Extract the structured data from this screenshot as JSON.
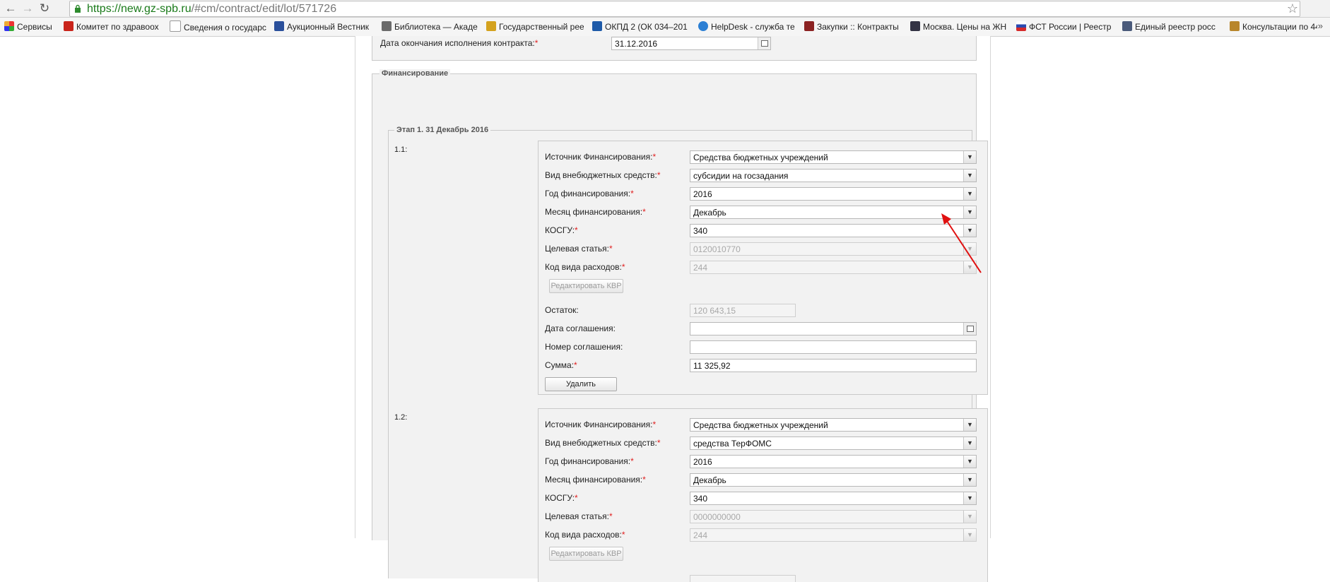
{
  "browser": {
    "url_host": "https://new.gz-spb.ru",
    "url_path": "/#cm/contract/edit/lot/571726",
    "bookmarks": [
      "Сервисы",
      "Комитет по здравоох",
      "Сведения о государс",
      "Аукционный Вестник",
      "Библиотека — Акаде",
      "Государственный рее",
      "ОКПД 2 (ОК 034–201",
      "HelpDesk - служба те",
      "Закупки :: Контракты",
      "Москва. Цены на ЖН",
      "ФСТ России | Реестр",
      "Единый реестр росс",
      "Консультации по 44"
    ]
  },
  "contract": {
    "end_date_label": "Дата окончания исполнения контракта:",
    "end_date_value": "31.12.2016"
  },
  "financing": {
    "legend": "Финансирование",
    "stage_legend": "Этап 1. 31 Декабрь 2016",
    "labels": {
      "source": "Источник Финансирования:",
      "kind": "Вид внебюджетных средств:",
      "year": "Год финансирования:",
      "month": "Месяц финансирования:",
      "kosgu": "КОСГУ:",
      "target": "Целевая статья:",
      "kvr": "Код вида расходов:",
      "edit_kvr": "Редактировать КВР",
      "remainder": "Остаток:",
      "agreement_date": "Дата соглашения:",
      "agreement_number": "Номер соглашения:",
      "sum": "Сумма:",
      "delete": "Удалить",
      "required_mark": "*"
    },
    "items": [
      {
        "number": "1.1:",
        "source": "Средства бюджетных учреждений",
        "kind": "субсидии на госзадания",
        "year": "2016",
        "month": "Декабрь",
        "kosgu": "340",
        "target": "0120010770",
        "kvr": "244",
        "remainder": "120 643,15",
        "agreement_date": "",
        "agreement_number": "",
        "sum": "11 325,92"
      },
      {
        "number": "1.2:",
        "source": "Средства бюджетных учреждений",
        "kind": "средства ТерФОМС",
        "year": "2016",
        "month": "Декабрь",
        "kosgu": "340",
        "target": "0000000000",
        "kvr": "244"
      }
    ]
  }
}
